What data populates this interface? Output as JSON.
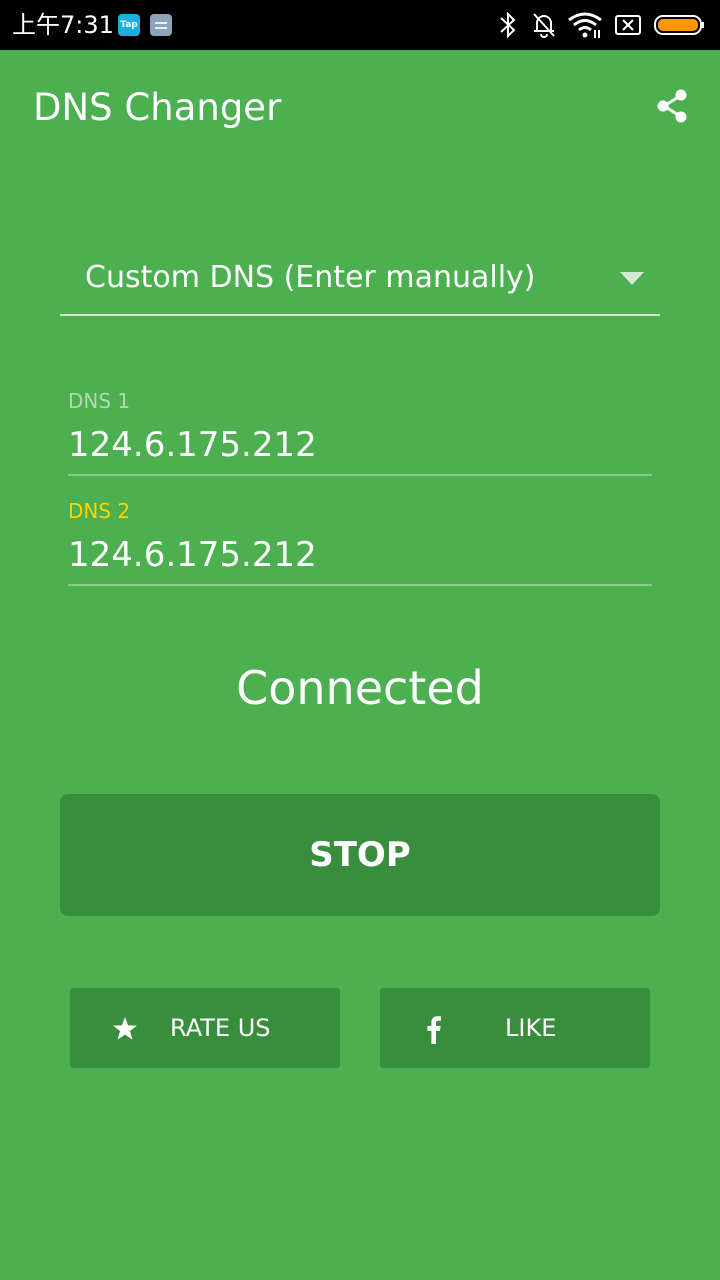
{
  "status_bar": {
    "time": "上午7:31",
    "tap_badge": "Tap",
    "icons": [
      "bluetooth-icon",
      "notifications-off-icon",
      "wifi-icon",
      "sim-x-icon",
      "battery-icon"
    ],
    "battery_color": "#ff9800"
  },
  "app_bar": {
    "title": "DNS Changer",
    "share_icon": "share-icon"
  },
  "dns_selector": {
    "selected": "Custom DNS (Enter manually)"
  },
  "fields": {
    "dns1": {
      "label": "DNS 1",
      "value": "124.6.175.212"
    },
    "dns2": {
      "label": "DNS 2",
      "value": "124.6.175.212"
    }
  },
  "status": "Connected",
  "stop_button": "STOP",
  "bottom_buttons": {
    "rate": {
      "label": "RATE US",
      "icon": "star-icon"
    },
    "like": {
      "label": "LIKE",
      "icon": "facebook-icon"
    }
  },
  "colors": {
    "background": "#4caf50",
    "button": "#388e3c",
    "accent": "#ffd400"
  }
}
